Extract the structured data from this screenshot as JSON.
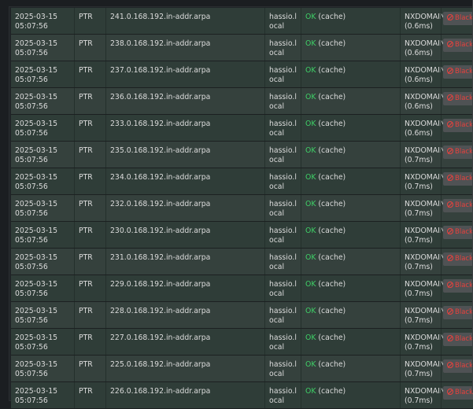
{
  "log": {
    "action_label": "Blacklist",
    "rows": [
      {
        "time": "2025-03-15 05:07:56",
        "type": "PTR",
        "domain": "241.0.168.192.in-addr.arpa",
        "client": "hassio.local",
        "status_ok": "OK",
        "status_note": "(cache)",
        "reply": "NXDOMAIN",
        "reply_time": "(0.6ms)"
      },
      {
        "time": "2025-03-15 05:07:56",
        "type": "PTR",
        "domain": "238.0.168.192.in-addr.arpa",
        "client": "hassio.local",
        "status_ok": "OK",
        "status_note": "(cache)",
        "reply": "NXDOMAIN",
        "reply_time": "(0.6ms)"
      },
      {
        "time": "2025-03-15 05:07:56",
        "type": "PTR",
        "domain": "237.0.168.192.in-addr.arpa",
        "client": "hassio.local",
        "status_ok": "OK",
        "status_note": "(cache)",
        "reply": "NXDOMAIN",
        "reply_time": "(0.6ms)"
      },
      {
        "time": "2025-03-15 05:07:56",
        "type": "PTR",
        "domain": "236.0.168.192.in-addr.arpa",
        "client": "hassio.local",
        "status_ok": "OK",
        "status_note": "(cache)",
        "reply": "NXDOMAIN",
        "reply_time": "(0.6ms)"
      },
      {
        "time": "2025-03-15 05:07:56",
        "type": "PTR",
        "domain": "233.0.168.192.in-addr.arpa",
        "client": "hassio.local",
        "status_ok": "OK",
        "status_note": "(cache)",
        "reply": "NXDOMAIN",
        "reply_time": "(0.6ms)"
      },
      {
        "time": "2025-03-15 05:07:56",
        "type": "PTR",
        "domain": "235.0.168.192.in-addr.arpa",
        "client": "hassio.local",
        "status_ok": "OK",
        "status_note": "(cache)",
        "reply": "NXDOMAIN",
        "reply_time": "(0.7ms)"
      },
      {
        "time": "2025-03-15 05:07:56",
        "type": "PTR",
        "domain": "234.0.168.192.in-addr.arpa",
        "client": "hassio.local",
        "status_ok": "OK",
        "status_note": "(cache)",
        "reply": "NXDOMAIN",
        "reply_time": "(0.7ms)"
      },
      {
        "time": "2025-03-15 05:07:56",
        "type": "PTR",
        "domain": "232.0.168.192.in-addr.arpa",
        "client": "hassio.local",
        "status_ok": "OK",
        "status_note": "(cache)",
        "reply": "NXDOMAIN",
        "reply_time": "(0.7ms)"
      },
      {
        "time": "2025-03-15 05:07:56",
        "type": "PTR",
        "domain": "230.0.168.192.in-addr.arpa",
        "client": "hassio.local",
        "status_ok": "OK",
        "status_note": "(cache)",
        "reply": "NXDOMAIN",
        "reply_time": "(0.7ms)"
      },
      {
        "time": "2025-03-15 05:07:56",
        "type": "PTR",
        "domain": "231.0.168.192.in-addr.arpa",
        "client": "hassio.local",
        "status_ok": "OK",
        "status_note": "(cache)",
        "reply": "NXDOMAIN",
        "reply_time": "(0.7ms)"
      },
      {
        "time": "2025-03-15 05:07:56",
        "type": "PTR",
        "domain": "229.0.168.192.in-addr.arpa",
        "client": "hassio.local",
        "status_ok": "OK",
        "status_note": "(cache)",
        "reply": "NXDOMAIN",
        "reply_time": "(0.7ms)"
      },
      {
        "time": "2025-03-15 05:07:56",
        "type": "PTR",
        "domain": "228.0.168.192.in-addr.arpa",
        "client": "hassio.local",
        "status_ok": "OK",
        "status_note": "(cache)",
        "reply": "NXDOMAIN",
        "reply_time": "(0.7ms)"
      },
      {
        "time": "2025-03-15 05:07:56",
        "type": "PTR",
        "domain": "227.0.168.192.in-addr.arpa",
        "client": "hassio.local",
        "status_ok": "OK",
        "status_note": "(cache)",
        "reply": "NXDOMAIN",
        "reply_time": "(0.7ms)"
      },
      {
        "time": "2025-03-15 05:07:56",
        "type": "PTR",
        "domain": "225.0.168.192.in-addr.arpa",
        "client": "hassio.local",
        "status_ok": "OK",
        "status_note": "(cache)",
        "reply": "NXDOMAIN",
        "reply_time": "(0.7ms)"
      },
      {
        "time": "2025-03-15 05:07:56",
        "type": "PTR",
        "domain": "226.0.168.192.in-addr.arpa",
        "client": "hassio.local",
        "status_ok": "OK",
        "status_note": "(cache)",
        "reply": "NXDOMAIN",
        "reply_time": "(0.7ms)"
      }
    ]
  },
  "colors": {
    "row_odd": "#2f3d38",
    "row_even": "#35413d",
    "ok": "#3fd167",
    "blacklist_text": "#e8413d",
    "button_bg": "#4f5254"
  },
  "icons": {
    "action_icon": "ban-icon"
  }
}
